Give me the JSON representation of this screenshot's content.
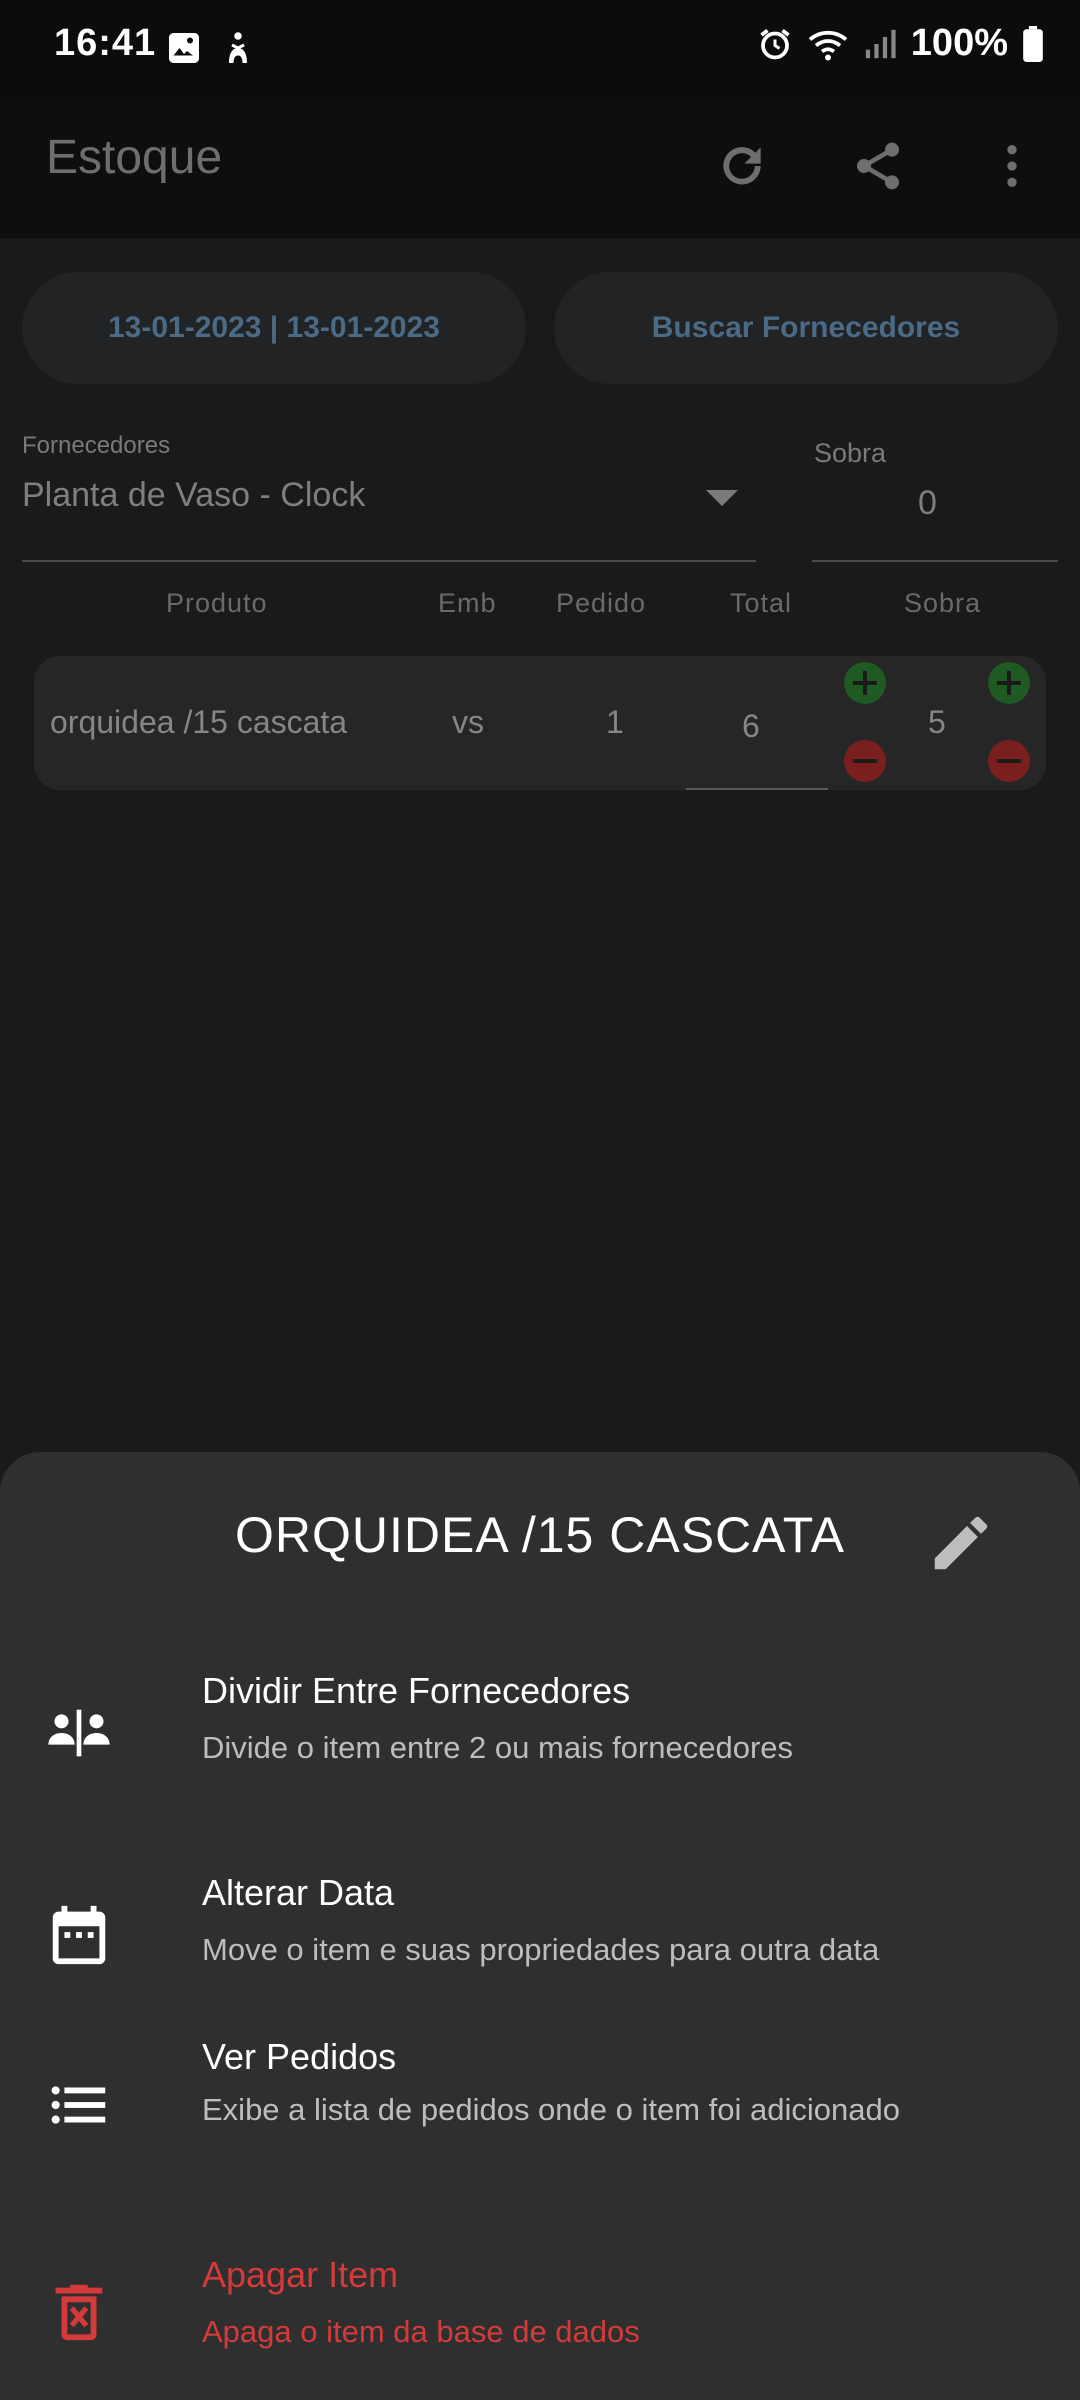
{
  "status_bar": {
    "time": "16:41",
    "battery": "100%",
    "icons": [
      "image-icon",
      "accessibility-icon",
      "alarm-icon",
      "wifi-icon",
      "signal-icon",
      "battery-icon"
    ]
  },
  "app_bar": {
    "title": "Estoque",
    "actions": [
      "refresh-icon",
      "share-icon",
      "more-vert-icon"
    ]
  },
  "filters": {
    "date_range": "13-01-2023 | 13-01-2023",
    "search_suppliers": "Buscar Fornecedores"
  },
  "supplier": {
    "label": "Fornecedores",
    "value": "Planta de Vaso - Clock"
  },
  "leftover": {
    "label": "Sobra",
    "value": "0"
  },
  "table": {
    "headers": [
      "Produto",
      "Emb",
      "Pedido",
      "Total",
      "Sobra"
    ],
    "row": {
      "produto": "orquidea /15 cascata",
      "emb": "vs",
      "pedido": "1",
      "total": "6",
      "sobra": "5"
    }
  },
  "sheet": {
    "title": "ORQUIDEA /15 CASCATA",
    "options": [
      {
        "title": "Dividir Entre Fornecedores",
        "subtitle": "Divide o item entre 2 ou mais fornecedores",
        "icon": "split-people-icon"
      },
      {
        "title": "Alterar Data",
        "subtitle": "Move o item e suas propriedades para outra data",
        "icon": "calendar-icon"
      },
      {
        "title": "Ver Pedidos",
        "subtitle": "Exibe a lista de pedidos onde o item foi adicionado",
        "icon": "list-icon"
      },
      {
        "title": "Apagar Item",
        "subtitle": "Apaga o item da base de dados",
        "icon": "delete-icon"
      }
    ]
  },
  "colors": {
    "accent_text": "#4a6a86",
    "plus_button": "#1f5a22",
    "minus_button": "#7a1e1e",
    "danger": "#d43a3a",
    "sheet_bg": "#2f2f2f"
  }
}
